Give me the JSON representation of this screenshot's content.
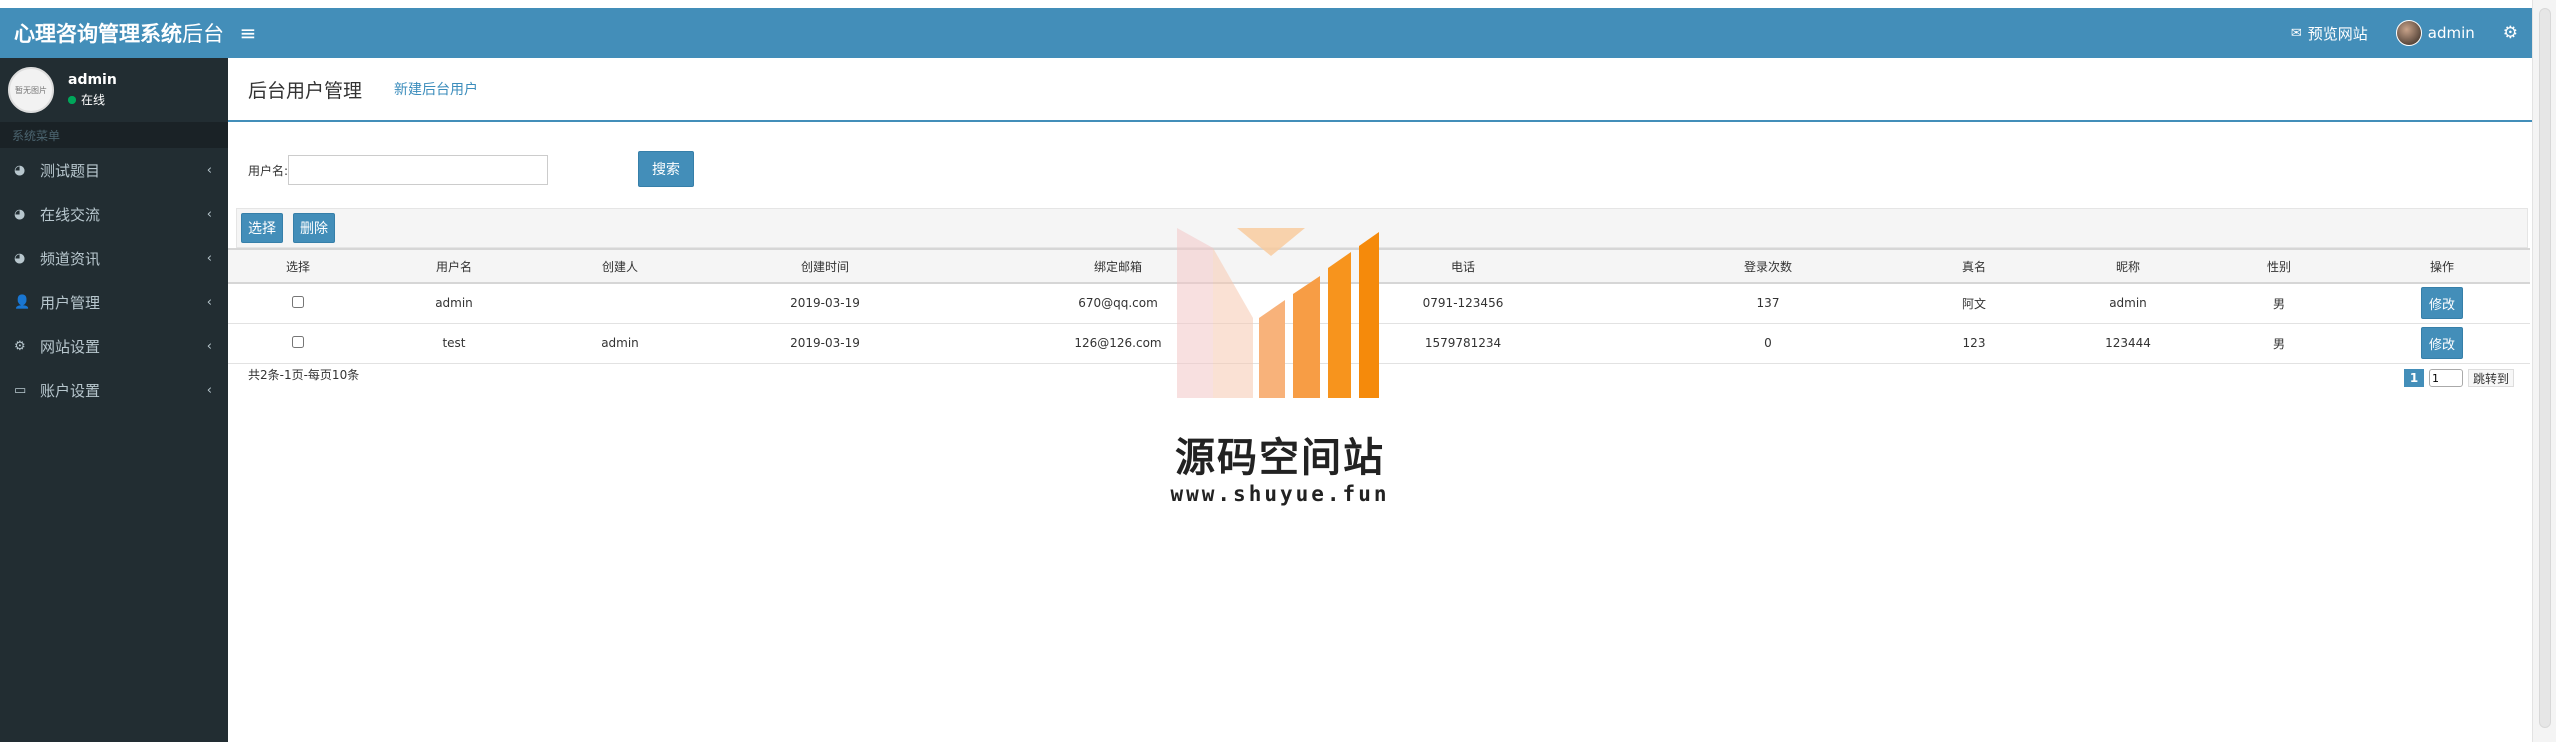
{
  "header": {
    "brand_bold": "心理咨询管理系统",
    "brand_light": "后台",
    "preview_label": "预览网站",
    "user_name": "admin"
  },
  "sidebar": {
    "avatar_text": "暂无图片",
    "user_name": "admin",
    "status": "在线",
    "section_label": "系统菜单",
    "items": [
      {
        "label": "测试题目",
        "icon": "pie-chart-icon"
      },
      {
        "label": "在线交流",
        "icon": "pie-chart-icon"
      },
      {
        "label": "频道资讯",
        "icon": "pie-chart-icon"
      },
      {
        "label": "用户管理",
        "icon": "user-icon"
      },
      {
        "label": "网站设置",
        "icon": "gear-icon"
      },
      {
        "label": "账户设置",
        "icon": "laptop-icon"
      }
    ]
  },
  "content": {
    "title": "后台用户管理",
    "new_link": "新建后台用户",
    "search_label": "用户名:",
    "search_value": "",
    "search_button": "搜索",
    "select_button": "选择",
    "delete_button": "删除"
  },
  "table": {
    "headers": [
      "选择",
      "用户名",
      "创建人",
      "创建时间",
      "绑定邮箱",
      "电话",
      "登录次数",
      "真名",
      "昵称",
      "性别",
      "操作"
    ],
    "rows": [
      {
        "username": "admin",
        "creator": "",
        "created": "2019-03-19",
        "email": "670@qq.com",
        "phone": "0791-123456",
        "logins": "137",
        "realname": "阿文",
        "nickname": "admin",
        "gender": "男",
        "action": "修改"
      },
      {
        "username": "test",
        "creator": "admin",
        "created": "2019-03-19",
        "email": "126@126.com",
        "phone": "1579781234",
        "logins": "0",
        "realname": "123",
        "nickname": "123444",
        "gender": "男",
        "action": "修改"
      }
    ]
  },
  "pagination": {
    "info": "共2条-1页-每页10条",
    "current": "1",
    "input_value": "1",
    "jump_label": "跳转到"
  },
  "watermark": {
    "title": "源码空间站",
    "url": "www.shuyue.fun"
  },
  "colors": {
    "header_blue": "#438eb9",
    "sidebar_dark": "#222d32",
    "watermark_orange": "#f7941d"
  }
}
